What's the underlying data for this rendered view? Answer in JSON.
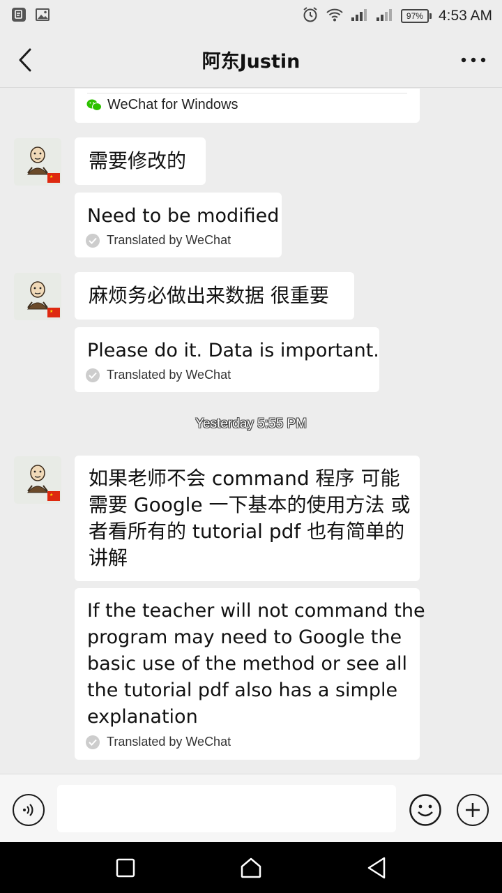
{
  "status_bar": {
    "time": "4:53 AM",
    "battery": "97%",
    "icons": [
      "notes-icon",
      "gallery-icon",
      "alarm-icon",
      "wifi-icon",
      "signal-icon",
      "signal-2-icon",
      "battery-icon"
    ]
  },
  "header": {
    "title": "阿东Justin",
    "back_icon": "back-arrow-icon",
    "more_icon": "more-dots-icon"
  },
  "messages": {
    "source_card": {
      "label": "WeChat for Windows",
      "icon": "wechat-logo-icon"
    },
    "m1": {
      "text": "需要修改的",
      "translation": "Need to be modified",
      "note": "Translated by WeChat"
    },
    "m2": {
      "text": "麻烦务必做出来数据 很重要",
      "translation": "Please do it. Data is important.",
      "note": "Translated by WeChat"
    },
    "timestamp": "Yesterday 5:55 PM",
    "m3": {
      "lines": [
        "如果老师不会 command 程序 可能",
        "需要 Google 一下基本的使用方法 或",
        "者看所有的 tutorial pdf 也有简单的",
        "讲解"
      ],
      "translation_lines": [
        "If the teacher will not command the",
        "program may need to Google the",
        "basic use of the method or see all",
        "the tutorial pdf also has a simple",
        "explanation"
      ],
      "note": "Translated by WeChat"
    }
  },
  "input_bar": {
    "placeholder": "",
    "icons": [
      "voice-icon",
      "emoji-icon",
      "plus-icon"
    ]
  },
  "system_nav": [
    "recents-icon",
    "home-icon",
    "back-triangle-icon"
  ]
}
